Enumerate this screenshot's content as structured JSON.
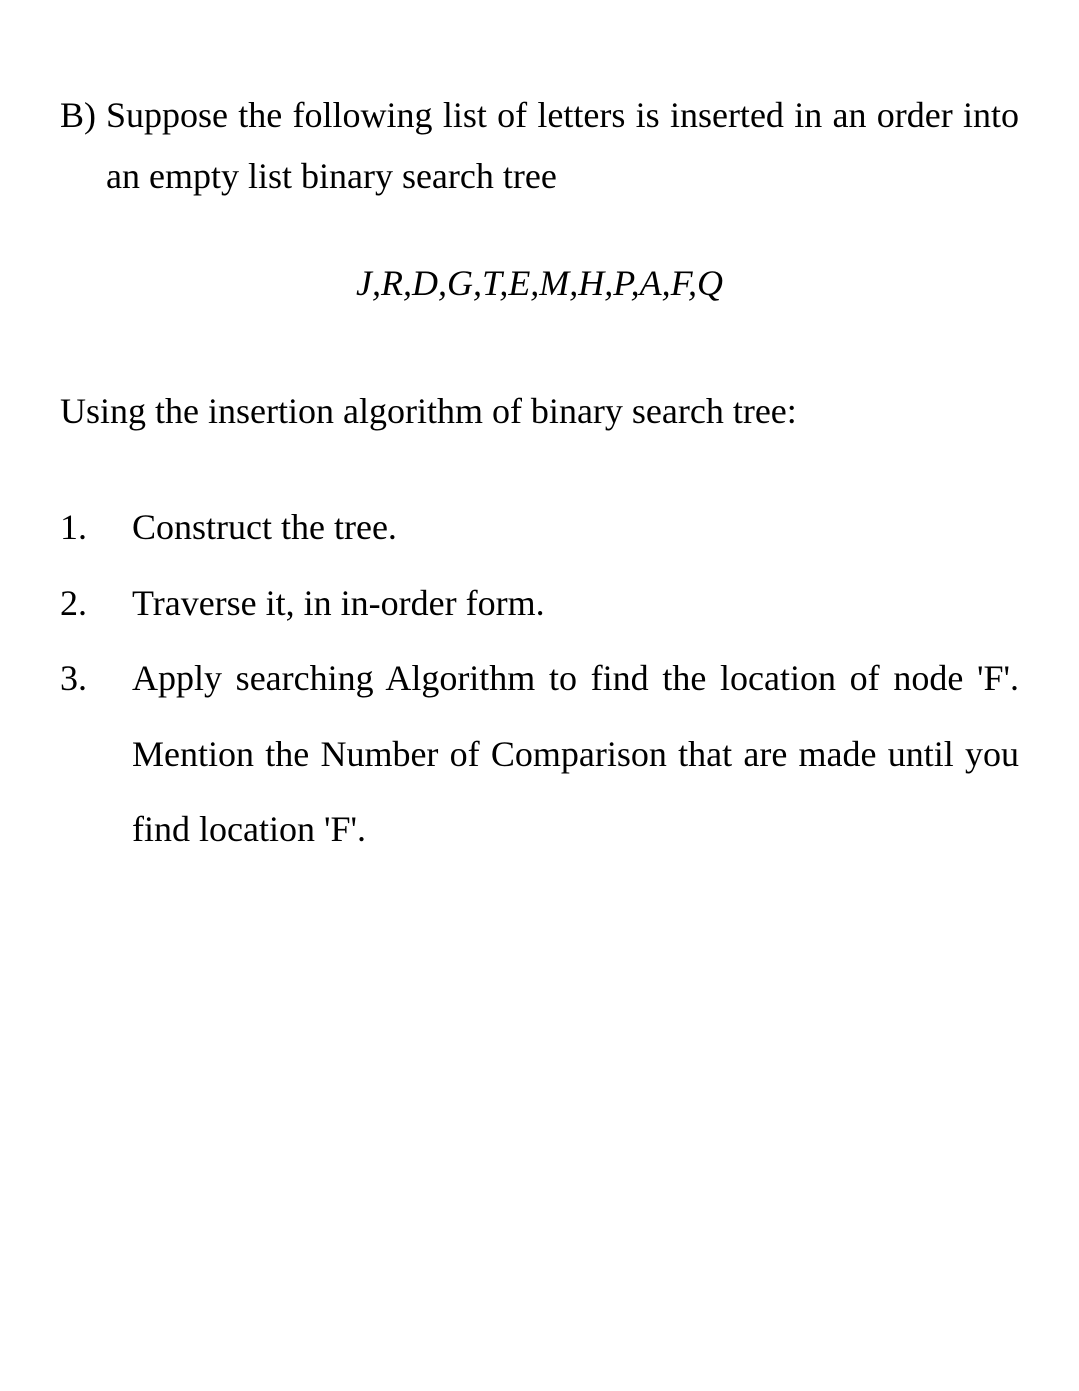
{
  "question": {
    "marker": "B)",
    "text": "Suppose the following list of letters is inserted in an order into an empty list binary search tree"
  },
  "letters": "J,R,D,G,T,E,M,H,P,A,F,Q",
  "intro": "Using the insertion algorithm of binary search tree:",
  "items": [
    {
      "num": "1.",
      "text": "Construct the tree."
    },
    {
      "num": "2.",
      "text": " Traverse it, in in-order form."
    },
    {
      "num": "3.",
      "text": " Apply searching Algorithm to find the location of node 'F'. Mention the Number of Comparison that are made until you find location 'F'."
    }
  ]
}
